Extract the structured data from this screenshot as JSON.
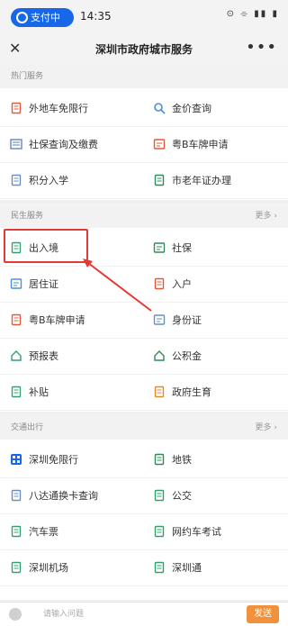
{
  "statusbar": {
    "pill_label": "支付中",
    "time": "14:35",
    "indicators": "⊙ ⌯ ▮▮ ▮"
  },
  "titlebar": {
    "close": "✕",
    "title": "深圳市政府城市服务",
    "more": "•••"
  },
  "sections": [
    {
      "title": "热门服务",
      "more": "",
      "items": [
        {
          "label": "外地车免限行",
          "icon": "doc-icon",
          "color": "#e05a38"
        },
        {
          "label": "金价查询",
          "icon": "search-icon",
          "color": "#4a8fd8"
        },
        {
          "label": "社保查询及缴费",
          "icon": "list-icon",
          "color": "#5a7db8"
        },
        {
          "label": "粤B车牌申请",
          "icon": "card-icon",
          "color": "#e05a38"
        },
        {
          "label": "积分入学",
          "icon": "doc-icon",
          "color": "#6a8fbf"
        },
        {
          "label": "市老年证办理",
          "icon": "doc-icon",
          "color": "#2e8b57"
        }
      ]
    },
    {
      "title": "民生服务",
      "more": "更多 ›",
      "items": [
        {
          "label": "出入境",
          "icon": "passport-icon",
          "color": "#2fa36b"
        },
        {
          "label": "社保",
          "icon": "card-icon",
          "color": "#2e8b57"
        },
        {
          "label": "居住证",
          "icon": "id-icon",
          "color": "#4a8fd8"
        },
        {
          "label": "入户",
          "icon": "doc-icon",
          "color": "#e05a38"
        },
        {
          "label": "粤B车牌申请",
          "icon": "doc-icon",
          "color": "#e05a38"
        },
        {
          "label": "身份证",
          "icon": "id-icon",
          "color": "#6a8fbf"
        },
        {
          "label": "预报表",
          "icon": "home-icon",
          "color": "#2fa36b"
        },
        {
          "label": "公积金",
          "icon": "house-icon",
          "color": "#2e8b57"
        },
        {
          "label": "补贴",
          "icon": "doc-icon",
          "color": "#2fa36b"
        },
        {
          "label": "政府生育",
          "icon": "doc-icon",
          "color": "#e08a20"
        }
      ]
    },
    {
      "title": "交通出行",
      "more": "更多 ›",
      "items": [
        {
          "label": "深圳免限行",
          "icon": "grid-icon",
          "color": "#1768e8"
        },
        {
          "label": "地铁",
          "icon": "doc-icon",
          "color": "#2e8b57"
        },
        {
          "label": "八达通换卡查询",
          "icon": "doc-icon",
          "color": "#6a8fbf"
        },
        {
          "label": "公交",
          "icon": "doc-icon",
          "color": "#2fa36b"
        },
        {
          "label": "汽车票",
          "icon": "doc-icon",
          "color": "#2fa36b"
        },
        {
          "label": "网约车考试",
          "icon": "doc-icon",
          "color": "#2fa36b"
        },
        {
          "label": "深圳机场",
          "icon": "doc-icon",
          "color": "#2fa36b"
        },
        {
          "label": "深圳通",
          "icon": "doc-icon",
          "color": "#2fa36b"
        }
      ]
    }
  ],
  "bottombar": {
    "placeholder": "请输入问题",
    "button": "发送"
  }
}
